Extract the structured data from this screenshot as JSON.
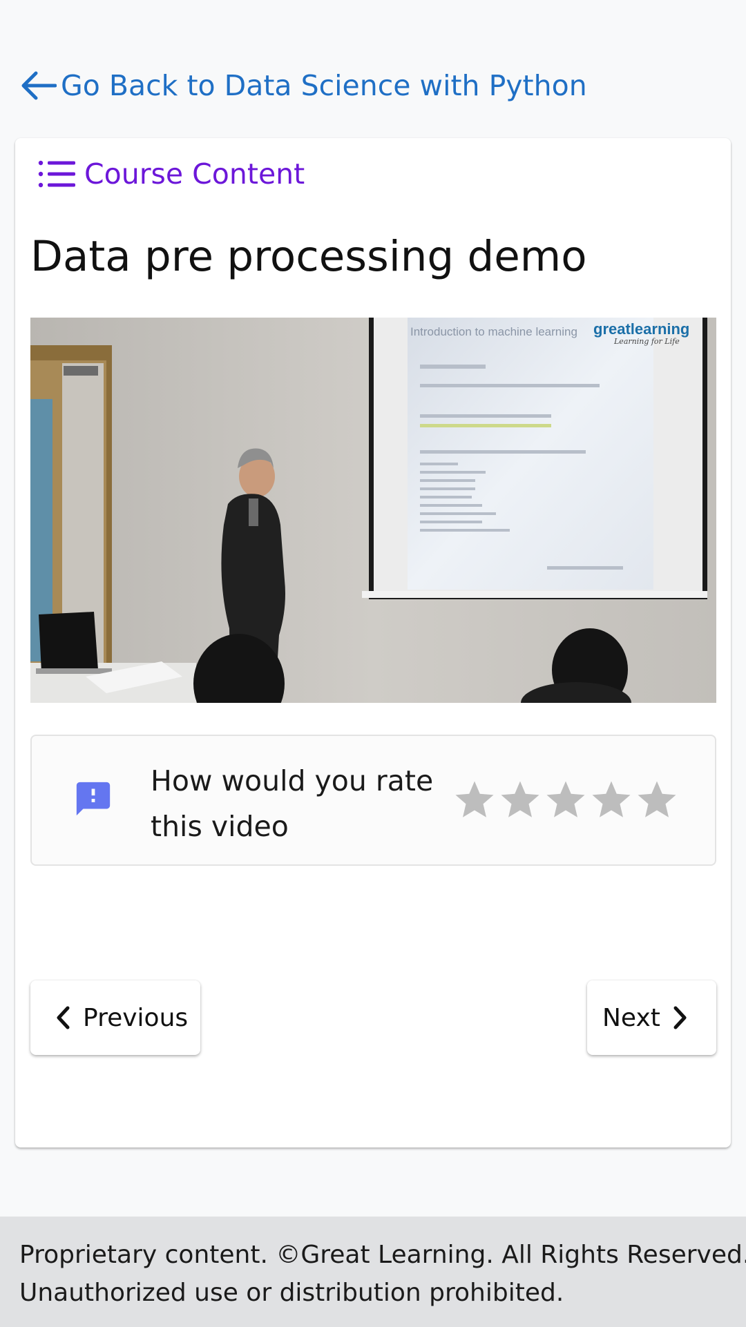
{
  "header": {
    "back_label": "Go Back to Data Science with Python",
    "back_icon": "arrow-left-icon"
  },
  "card": {
    "course_content_label": "Course Content",
    "course_content_icon": "list-icon",
    "lesson_title": "Data pre processing demo",
    "video": {
      "slide_heading": "Introduction to machine learning",
      "brand_name": "greatlearning",
      "brand_tagline": "Learning for Life"
    },
    "rating": {
      "question": "How would you rate this video",
      "icon": "feedback-icon",
      "stars_total": 5,
      "stars_selected": 0
    },
    "navigation": {
      "previous_label": "Previous",
      "next_label": "Next"
    }
  },
  "footer": {
    "line1": "Proprietary content. ©Great Learning. All Rights Reserved.",
    "line2": "Unauthorized use or distribution prohibited."
  },
  "colors": {
    "link_blue": "#1f6fc5",
    "course_purple": "#6c17d9",
    "feedback_icon": "#6476f0",
    "star_grey": "#bdbdbd",
    "footer_bg": "#e0e1e3",
    "page_bg": "#f8f9fa"
  }
}
